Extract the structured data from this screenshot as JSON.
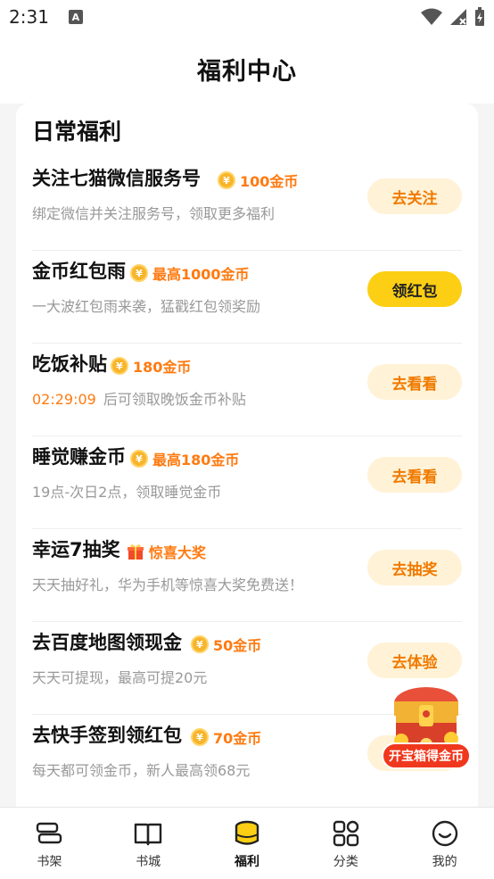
{
  "status_bar": {
    "time": "2:31",
    "notification_glyph": "A"
  },
  "header": {
    "title": "福利中心"
  },
  "section": {
    "title": "日常福利"
  },
  "tasks": [
    {
      "name": "关注七猫微信服务号",
      "reward_icon": "coin-icon",
      "reward": "100金币",
      "desc": "绑定微信并关注服务号，领取更多福利",
      "timer": "",
      "button": "去关注",
      "button_style": "secondary"
    },
    {
      "name": "金币红包雨",
      "reward_icon": "coin-icon",
      "reward": "最高1000金币",
      "desc": "一大波红包雨来袭，猛戳红包领奖励",
      "timer": "",
      "button": "领红包",
      "button_style": "primary"
    },
    {
      "name": "吃饭补贴",
      "reward_icon": "coin-icon",
      "reward": "180金币",
      "desc": "后可领取晚饭金币补贴",
      "timer": "02:29:09",
      "button": "去看看",
      "button_style": "secondary"
    },
    {
      "name": "睡觉赚金币",
      "reward_icon": "coin-icon",
      "reward": "最高180金币",
      "desc": "19点-次日2点，领取睡觉金币",
      "timer": "",
      "button": "去看看",
      "button_style": "secondary"
    },
    {
      "name": "幸运7抽奖",
      "reward_icon": "gift-icon",
      "reward": "惊喜大奖",
      "desc": "天天抽好礼，华为手机等惊喜大奖免费送！",
      "timer": "",
      "button": "去抽奖",
      "button_style": "secondary"
    },
    {
      "name": "去百度地图领现金",
      "reward_icon": "coin-icon",
      "reward": "50金币",
      "desc": "天天可提现，最高可提20元",
      "timer": "",
      "button": "去体验",
      "button_style": "secondary"
    },
    {
      "name": "去快手签到领红包",
      "reward_icon": "coin-icon",
      "reward": "70金币",
      "desc": "每天都可领金币，新人最高领68元",
      "timer": "",
      "button": "",
      "button_style": "secondary"
    }
  ],
  "coin_symbol": "¥",
  "treasure": {
    "label": "开宝箱得金币"
  },
  "tabs": [
    {
      "label": "书架",
      "icon": "bookshelf-icon",
      "active": false
    },
    {
      "label": "书城",
      "icon": "book-open-icon",
      "active": false
    },
    {
      "label": "福利",
      "icon": "welfare-icon",
      "active": true
    },
    {
      "label": "分类",
      "icon": "grid-icon",
      "active": false
    },
    {
      "label": "我的",
      "icon": "smile-face-icon",
      "active": false
    }
  ],
  "colors": {
    "accent_yellow": "#fccf14",
    "reward_orange": "#ff7a10",
    "button_bg": "#fff2d6"
  }
}
